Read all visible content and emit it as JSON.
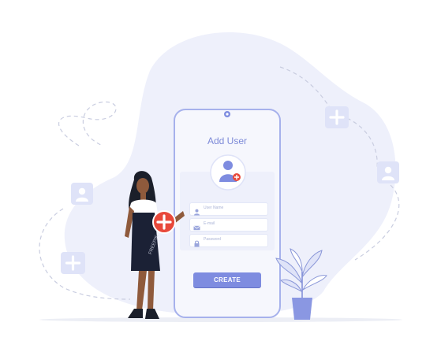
{
  "form": {
    "title": "Add User",
    "fields": [
      {
        "placeholder": "User Name",
        "icon": "user-icon"
      },
      {
        "placeholder": "E-mail",
        "icon": "mail-icon"
      },
      {
        "placeholder": "Password",
        "icon": "lock-icon"
      }
    ],
    "create_label": "CREATE"
  },
  "watermark": "FREEPIK",
  "colors": {
    "accent": "#7e8ce0",
    "blob": "#eef0fb",
    "badge_red": "#e8493b",
    "phone_outline": "#a6b1ec"
  }
}
